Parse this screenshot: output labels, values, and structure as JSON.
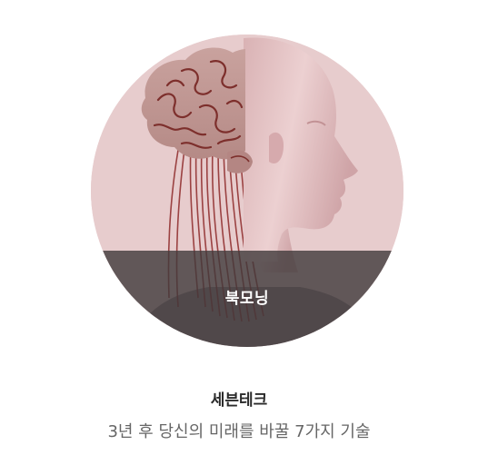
{
  "cover": {
    "image": "brain-and-head-illustration",
    "category_label": "북모닝"
  },
  "book": {
    "title": "세븐테크",
    "description": "3년 후 당신의 미래를 바꿀 7가지 기술"
  },
  "colors": {
    "cover_background": "#e7cccd",
    "band_overlay": "#403a3b",
    "title_text": "#2b2b2b",
    "description_text": "#666666"
  }
}
